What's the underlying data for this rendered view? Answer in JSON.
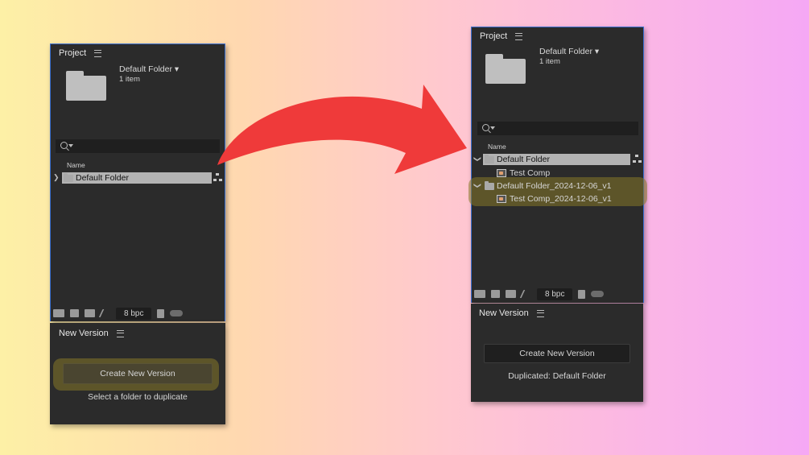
{
  "left": {
    "project_panel": {
      "title": "Project",
      "folder_name": "Default Folder ▾",
      "item_count": "1 item",
      "column_header": "Name",
      "rows": [
        {
          "label": "Default Folder",
          "type": "folder",
          "selected": true
        }
      ],
      "toolbar": {
        "bpc_label": "8 bpc"
      }
    },
    "new_version_panel": {
      "title": "New Version",
      "button_label": "Create New Version",
      "status": "Select a folder to duplicate"
    }
  },
  "right": {
    "project_panel": {
      "title": "Project",
      "folder_name": "Default Folder ▾",
      "item_count": "1 item",
      "column_header": "Name",
      "rows": [
        {
          "label": "Default Folder",
          "type": "folder",
          "selected": true
        },
        {
          "label": "Test Comp",
          "type": "comp",
          "selected": false
        },
        {
          "label": "Default Folder_2024-12-06_v1",
          "type": "folder",
          "selected": false
        },
        {
          "label": "Test Comp_2024-12-06_v1",
          "type": "comp",
          "selected": false
        }
      ],
      "toolbar": {
        "bpc_label": "8 bpc"
      }
    },
    "new_version_panel": {
      "title": "New Version",
      "button_label": "Create New Version",
      "status": "Duplicated: Default Folder"
    }
  },
  "colors": {
    "panel_bg": "#2b2b2b",
    "highlight": "#877828",
    "arrow": "#ef3a3a",
    "selection": "#b3b3b3"
  }
}
